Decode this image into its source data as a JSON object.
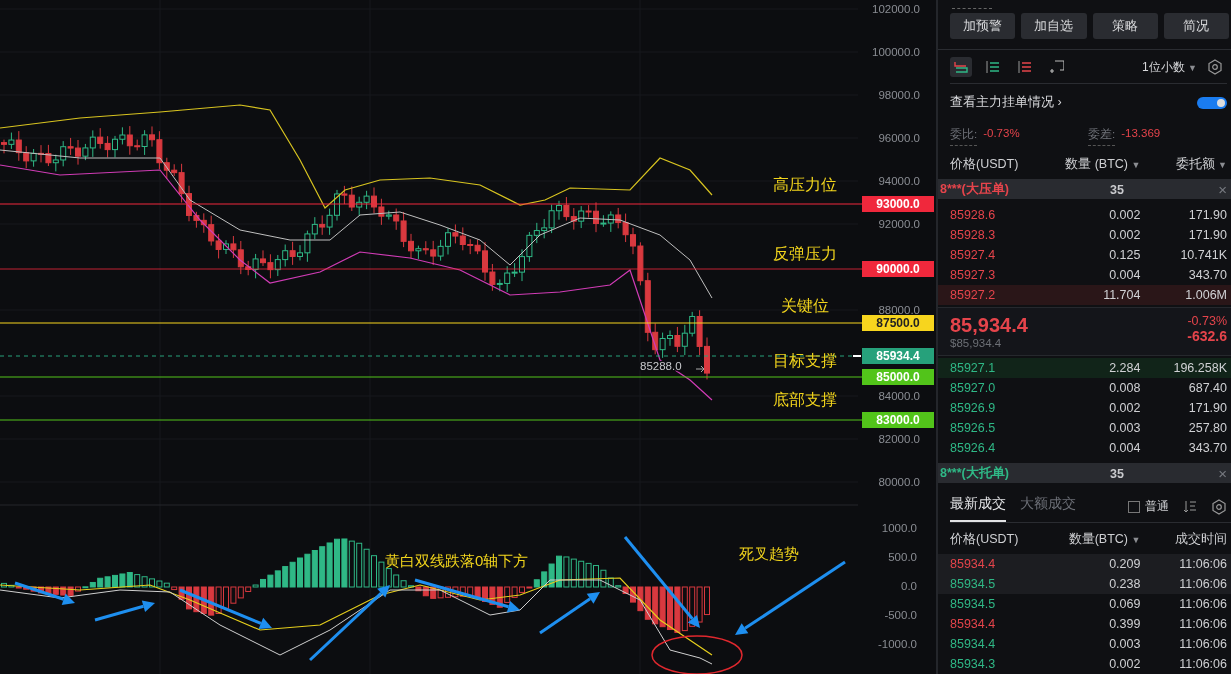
{
  "chart": {
    "price_axis": [
      "102000.0",
      "100000.0",
      "98000.0",
      "96000.0",
      "94000.0",
      "92000.0",
      "88000.0",
      "84000.0",
      "82000.0",
      "80000.0"
    ],
    "price_lines": [
      {
        "label": "93000.0",
        "color": "#f0283c",
        "dashed": false
      },
      {
        "label": "90000.0",
        "color": "#f0283c",
        "dashed": false
      },
      {
        "label": "87500.0",
        "color": "#f7d51e",
        "dashed": false
      },
      {
        "label": "85934.4",
        "color": "#26a17b",
        "dashed": true
      },
      {
        "label": "85000.0",
        "color": "#52c41a",
        "dashed": false
      },
      {
        "label": "83000.0",
        "color": "#52c41a",
        "dashed": false
      }
    ],
    "notes": [
      "高压力位",
      "反弹压力",
      "关键位",
      "目标支撑",
      "底部支撑"
    ],
    "low_marker": "85288.0",
    "macd_axis": [
      "1000.0",
      "500.0",
      "0.0",
      "-500.0",
      "-1000.0"
    ],
    "macd_notes": [
      "黄白双线跌落0轴下方",
      "死叉趋势"
    ]
  },
  "panel": {
    "buttons": [
      "加预警",
      "加自选",
      "策略",
      "简况"
    ],
    "view_modes": [
      {
        "kind": "split",
        "selected": true
      },
      {
        "kind": "buy",
        "selected": false
      },
      {
        "kind": "sell",
        "selected": false
      },
      {
        "kind": "add",
        "selected": false
      }
    ],
    "precision": "1位小数",
    "precision_caret": "▼",
    "depth_link": "查看主力挂单情况",
    "depth_link_arrow": "›",
    "depth_toggle": {
      "on": true
    },
    "ratio_label": "委比:",
    "ratio_value": "-0.73%",
    "diff_label": "委差:",
    "diff_value": "-13.369",
    "book_columns": [
      {
        "label": "价格(USDT)"
      },
      {
        "label": "数量 (BTC)",
        "caret": "▼"
      },
      {
        "label": "委托额",
        "caret": "▼"
      }
    ],
    "ask_banner": {
      "label": "8***(大压单)",
      "amount": "35",
      "close": "×"
    },
    "asks": [
      {
        "price": "85928.6",
        "qty": "0.002",
        "total": "171.90",
        "highlighted": false
      },
      {
        "price": "85928.3",
        "qty": "0.002",
        "total": "171.90",
        "highlighted": false
      },
      {
        "price": "85927.4",
        "qty": "0.125",
        "total": "10.741K",
        "highlighted": false
      },
      {
        "price": "85927.3",
        "qty": "0.004",
        "total": "343.70",
        "highlighted": false
      },
      {
        "price": "85927.2",
        "qty": "11.704",
        "total": "1.006M",
        "highlighted": true
      }
    ],
    "last_price": "85,934.4",
    "last_usd": "$85,934.4",
    "change_pct": "-0.73%",
    "change_abs": "-632.6",
    "bids": [
      {
        "price": "85927.1",
        "qty": "2.284",
        "total": "196.258K",
        "highlighted": true
      },
      {
        "price": "85927.0",
        "qty": "0.008",
        "total": "687.40",
        "highlighted": false
      },
      {
        "price": "85926.9",
        "qty": "0.002",
        "total": "171.90",
        "highlighted": false
      },
      {
        "price": "85926.5",
        "qty": "0.003",
        "total": "257.80",
        "highlighted": false
      },
      {
        "price": "85926.4",
        "qty": "0.004",
        "total": "343.70",
        "highlighted": false
      }
    ],
    "bid_banner": {
      "label": "8***(大托单)",
      "amount": "35",
      "close": "×"
    },
    "trade_tabs": [
      {
        "label": "最新成交",
        "selected": true
      },
      {
        "label": "大额成交",
        "selected": false
      }
    ],
    "normal_filter": {
      "label": "普通",
      "checked": false
    },
    "trade_columns": [
      {
        "label": "价格(USDT)"
      },
      {
        "label": "数量(BTC)",
        "caret": "▼"
      },
      {
        "label": "成交时间"
      }
    ],
    "trades": [
      {
        "price": "85934.4",
        "color": "#e5444b",
        "qty": "0.209",
        "time": "11:06:06",
        "highlighted": true
      },
      {
        "price": "85934.5",
        "color": "#2fb886",
        "qty": "0.238",
        "time": "11:06:06",
        "highlighted": true
      },
      {
        "price": "85934.5",
        "color": "#2fb886",
        "qty": "0.069",
        "time": "11:06:06",
        "highlighted": false
      },
      {
        "price": "85934.4",
        "color": "#e5444b",
        "qty": "0.399",
        "time": "11:06:06",
        "highlighted": false
      },
      {
        "price": "85934.4",
        "color": "#2fb886",
        "qty": "0.003",
        "time": "11:06:06",
        "highlighted": false
      },
      {
        "price": "85934.3",
        "color": "#2fb886",
        "qty": "0.002",
        "time": "11:06:06",
        "highlighted": false
      }
    ]
  }
}
